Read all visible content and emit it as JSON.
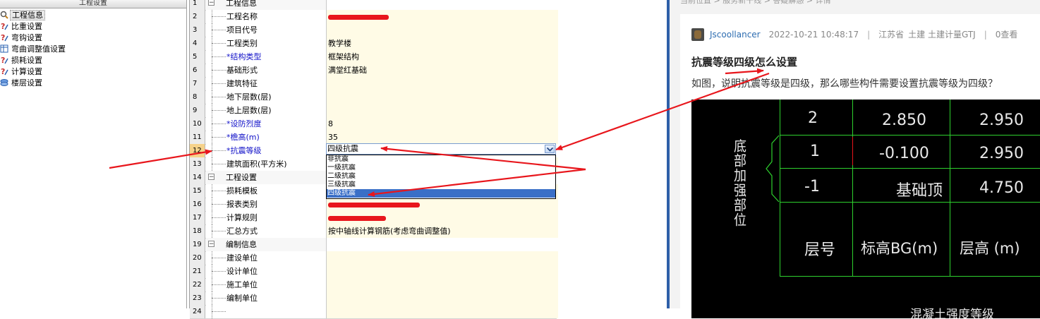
{
  "tree": {
    "header": "工程设置",
    "items": [
      {
        "label": "工程信息",
        "icon": "magnifier-icon",
        "selected": true
      },
      {
        "label": "比重设置",
        "icon": "question-icon"
      },
      {
        "label": "弯钩设置",
        "icon": "question-icon"
      },
      {
        "label": "弯曲调整值设置",
        "icon": "table-icon"
      },
      {
        "label": "损耗设置",
        "icon": "question-icon"
      },
      {
        "label": "计算设置",
        "icon": "question-icon"
      },
      {
        "label": "楼层设置",
        "icon": "layers-icon"
      }
    ]
  },
  "grid": {
    "rows": [
      {
        "n": "1",
        "name": "工程信息",
        "value": "",
        "section": true
      },
      {
        "n": "2",
        "name": "工程名称",
        "value": "",
        "redacted": 86
      },
      {
        "n": "3",
        "name": "项目代号",
        "value": ""
      },
      {
        "n": "4",
        "name": "工程类别",
        "value": "教学楼"
      },
      {
        "n": "5",
        "name": "*结构类型",
        "value": "框架结构",
        "blue": true
      },
      {
        "n": "6",
        "name": "基础形式",
        "value": "满堂红基础"
      },
      {
        "n": "7",
        "name": "建筑特征",
        "value": ""
      },
      {
        "n": "8",
        "name": "地下层数(层)",
        "value": ""
      },
      {
        "n": "9",
        "name": "地上层数(层)",
        "value": ""
      },
      {
        "n": "10",
        "name": "*设防烈度",
        "value": "8",
        "blue": true
      },
      {
        "n": "11",
        "name": "*檐高(m)",
        "value": "35",
        "blue": true
      },
      {
        "n": "12",
        "name": "*抗震等级",
        "value": "",
        "blue": true,
        "current": true
      },
      {
        "n": "13",
        "name": "建筑面积(平方米)",
        "value": ""
      },
      {
        "n": "14",
        "name": "工程设置",
        "value": "",
        "section": true
      },
      {
        "n": "15",
        "name": "损耗模板",
        "value": ""
      },
      {
        "n": "16",
        "name": "报表类别",
        "value": "",
        "redacted": 130
      },
      {
        "n": "17",
        "name": "计算规则",
        "value": "",
        "redacted": 82
      },
      {
        "n": "18",
        "name": "汇总方式",
        "value": "按中轴线计算钢筋(考虑弯曲调整值)"
      },
      {
        "n": "19",
        "name": "编制信息",
        "value": "",
        "section": true
      },
      {
        "n": "20",
        "name": "建设单位",
        "value": ""
      },
      {
        "n": "21",
        "name": "设计单位",
        "value": ""
      },
      {
        "n": "22",
        "name": "施工单位",
        "value": ""
      },
      {
        "n": "23",
        "name": "编制单位",
        "value": ""
      },
      {
        "n": "24",
        "name": "",
        "value": ""
      }
    ],
    "combo_value": "四级抗震",
    "options": [
      "非抗震",
      "一级抗震",
      "二级抗震",
      "三级抗震",
      "四级抗震"
    ],
    "selected_option": 4
  },
  "post": {
    "breadcrumb": "当前位置 > 服务新干线 > 答疑解惑 > 详情",
    "author": "Jscoollancer",
    "datetime": "2022-10-21 10:48:17",
    "location": "江苏省",
    "tags": "土建 土建计量GTJ",
    "views": "0查看",
    "title": "抗震等级四级怎么设置",
    "body": "如图，说明抗震等级是四级，那么哪些构件需要设置抗震等级为四级？",
    "image": {
      "side_label": "底部加强部位",
      "rows": [
        {
          "floor": "2",
          "elev": "2.850",
          "height": "2.950"
        },
        {
          "floor": "1",
          "elev": "-0.100",
          "height": "2.950"
        },
        {
          "floor": "-1",
          "elev": "基础顶",
          "height": "4.750"
        }
      ],
      "header": {
        "floor": "层号",
        "elev": "标高BG(m)",
        "height": "层高 (m)"
      },
      "footer": "混凝土强度等级"
    }
  },
  "colors": {
    "annotation_arrow": "#e8161c",
    "cad_grid": "#2ed12e",
    "selection": "#3a6fc7",
    "divider": "#2e5fa8"
  }
}
